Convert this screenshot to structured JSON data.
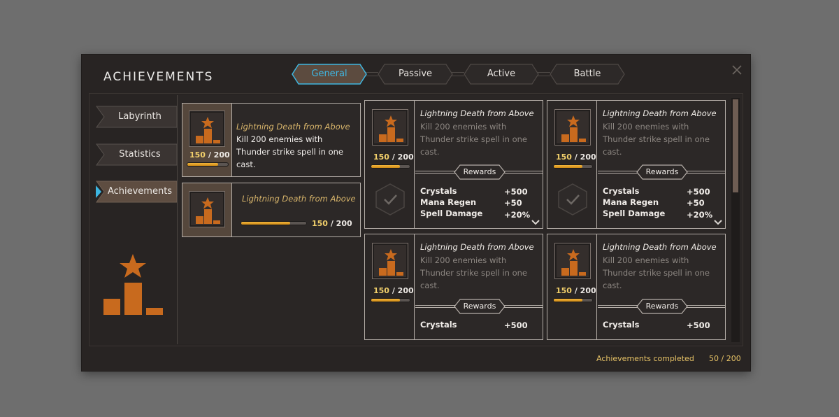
{
  "window": {
    "title": "ACHIEVEMENTS"
  },
  "tabs": [
    {
      "label": "General",
      "active": true
    },
    {
      "label": "Passive",
      "active": false
    },
    {
      "label": "Active",
      "active": false
    },
    {
      "label": "Battle",
      "active": false
    }
  ],
  "sidebar": {
    "items": [
      {
        "label": "Labyrinth",
        "selected": false
      },
      {
        "label": "Statistics",
        "selected": false
      },
      {
        "label": "Achievements",
        "selected": true
      }
    ],
    "icon": "podium-star-icon"
  },
  "list_cards": [
    {
      "title": "Lightning Death from Above",
      "description": "Kill 200 enemies with Thunder strike spell in one cast.",
      "progress_current": "150",
      "progress_total": "/ 200",
      "progress_fraction": 0.75
    },
    {
      "title": "Lightning Death from Above",
      "progress_current": "150",
      "progress_total": "/ 200",
      "progress_fraction": 0.75
    }
  ],
  "grid_cards": [
    {
      "title": "Lightning Death from Above",
      "description": "Kill 200 enemies with Thunder strike spell in one cast.",
      "progress_current": "150",
      "progress_total": "/ 200",
      "progress_fraction": 0.75,
      "rewards_label": "Rewards",
      "rewards": [
        {
          "name": "Crystals",
          "value": "+500"
        },
        {
          "name": "Mana Regen",
          "value": "+50"
        },
        {
          "name": "Spell Damage",
          "value": "+20%"
        }
      ]
    },
    {
      "title": "Lightning Death from Above",
      "description": "Kill 200 enemies with Thunder strike spell in one cast.",
      "progress_current": "150",
      "progress_total": "/ 200",
      "progress_fraction": 0.75,
      "rewards_label": "Rewards",
      "rewards": [
        {
          "name": "Crystals",
          "value": "+500"
        },
        {
          "name": "Mana Regen",
          "value": "+50"
        },
        {
          "name": "Spell Damage",
          "value": "+20%"
        }
      ]
    },
    {
      "title": "Lightning Death from Above",
      "description": "Kill 200 enemies with Thunder strike spell in one cast.",
      "progress_current": "150",
      "progress_total": "/ 200",
      "progress_fraction": 0.75,
      "rewards_label": "Rewards",
      "rewards": [
        {
          "name": "Crystals",
          "value": "+500"
        }
      ]
    },
    {
      "title": "Lightning Death from Above",
      "description": "Kill 200 enemies with Thunder strike spell in one cast.",
      "progress_current": "150",
      "progress_total": "/ 200",
      "progress_fraction": 0.75,
      "rewards_label": "Rewards",
      "rewards": [
        {
          "name": "Crystals",
          "value": "+500"
        }
      ]
    }
  ],
  "footer": {
    "label": "Achievements completed",
    "count": "50 / 200"
  },
  "colors": {
    "accent_orange": "#c86a1e",
    "active_tab_text": "#3eb9e6",
    "gold_text": "#e6c266",
    "progress_fill": "#e09a24"
  }
}
